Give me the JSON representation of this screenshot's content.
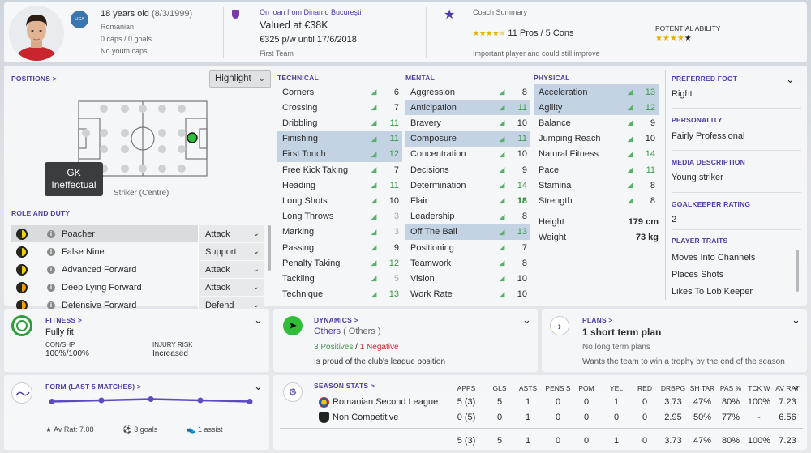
{
  "header": {
    "age": "18 years old",
    "dob": "(8/3/1999)",
    "nationality": "Romanian",
    "caps": "0 caps / 0 goals",
    "youth_caps": "No youth caps",
    "club_badge": "LIGA",
    "loan": "On loan from Dinamo Bucureşti",
    "value": "Valued at €38K",
    "wage": "€325 p/w until 17/6/2018",
    "squad": "First Team",
    "coach_title": "Coach Summary",
    "pros_cons": "11 Pros / 5 Cons",
    "coach_stars": "★★★★",
    "coach_star_half": "★",
    "coach_comment": "Important player and could still improve",
    "potential_title": "POTENTIAL ABILITY",
    "potential_stars": "★★★★",
    "potential_star_dark": "★"
  },
  "positions": {
    "title": "POSITIONS >",
    "highlight": "Highlight",
    "tooltip_line1": "GK",
    "tooltip_line2": "Ineffectual",
    "position_label": "Striker (Centre)"
  },
  "roles": {
    "title": "ROLE AND DUTY",
    "items": [
      {
        "name": "Poacher",
        "duty": "Attack"
      },
      {
        "name": "False Nine",
        "duty": "Support"
      },
      {
        "name": "Advanced Forward",
        "duty": "Attack"
      },
      {
        "name": "Deep Lying Forward",
        "duty": "Attack"
      },
      {
        "name": "Defensive Forward",
        "duty": "Defend"
      }
    ]
  },
  "technical": {
    "title": "TECHNICAL",
    "items": [
      {
        "name": "Corners",
        "value": "6"
      },
      {
        "name": "Crossing",
        "value": "7"
      },
      {
        "name": "Dribbling",
        "value": "11"
      },
      {
        "name": "Finishing",
        "value": "11"
      },
      {
        "name": "First Touch",
        "value": "12"
      },
      {
        "name": "Free Kick Taking",
        "value": "7"
      },
      {
        "name": "Heading",
        "value": "11"
      },
      {
        "name": "Long Shots",
        "value": "10"
      },
      {
        "name": "Long Throws",
        "value": "3"
      },
      {
        "name": "Marking",
        "value": "3"
      },
      {
        "name": "Passing",
        "value": "9"
      },
      {
        "name": "Penalty Taking",
        "value": "12"
      },
      {
        "name": "Tackling",
        "value": "5"
      },
      {
        "name": "Technique",
        "value": "13"
      }
    ]
  },
  "mental": {
    "title": "MENTAL",
    "items": [
      {
        "name": "Aggression",
        "value": "8"
      },
      {
        "name": "Anticipation",
        "value": "11"
      },
      {
        "name": "Bravery",
        "value": "10"
      },
      {
        "name": "Composure",
        "value": "11"
      },
      {
        "name": "Concentration",
        "value": "10"
      },
      {
        "name": "Decisions",
        "value": "9"
      },
      {
        "name": "Determination",
        "value": "14"
      },
      {
        "name": "Flair",
        "value": "18"
      },
      {
        "name": "Leadership",
        "value": "8"
      },
      {
        "name": "Off The Ball",
        "value": "13"
      },
      {
        "name": "Positioning",
        "value": "7"
      },
      {
        "name": "Teamwork",
        "value": "8"
      },
      {
        "name": "Vision",
        "value": "10"
      },
      {
        "name": "Work Rate",
        "value": "10"
      }
    ]
  },
  "physical": {
    "title": "PHYSICAL",
    "items": [
      {
        "name": "Acceleration",
        "value": "13"
      },
      {
        "name": "Agility",
        "value": "12"
      },
      {
        "name": "Balance",
        "value": "9"
      },
      {
        "name": "Jumping Reach",
        "value": "10"
      },
      {
        "name": "Natural Fitness",
        "value": "14"
      },
      {
        "name": "Pace",
        "value": "11"
      },
      {
        "name": "Stamina",
        "value": "8"
      },
      {
        "name": "Strength",
        "value": "8"
      }
    ],
    "height_label": "Height",
    "height": "179 cm",
    "weight_label": "Weight",
    "weight": "73 kg"
  },
  "info": {
    "foot_title": "PREFERRED FOOT",
    "foot": "Right",
    "personality_title": "PERSONALITY",
    "personality": "Fairly Professional",
    "media_title": "MEDIA DESCRIPTION",
    "media": "Young striker",
    "gk_title": "GOALKEEPER RATING",
    "gk": "2",
    "traits_title": "PLAYER TRAITS",
    "traits": [
      "Moves Into Channels",
      "Places Shots",
      "Likes To Lob Keeper"
    ]
  },
  "fitness": {
    "title": "FITNESS >",
    "status": "Fully fit",
    "con_label": "CON/SHP",
    "con": "100%/100%",
    "injury_label": "INJURY RISK",
    "injury": "Increased"
  },
  "dynamics": {
    "title": "DYNAMICS >",
    "group": "Others",
    "group_paren": "( Others )",
    "positives": "3 Positives",
    "sep": "/",
    "negatives": "1 Negative",
    "note": "Is proud of the club's league position"
  },
  "plans": {
    "title": "PLANS >",
    "short": "1 short term plan",
    "long": "No long term plans",
    "note": "Wants the team to win a trophy by the end of the season"
  },
  "form": {
    "title": "FORM (LAST 5 MATCHES) >",
    "ratings": [
      7.05,
      7.1,
      7.15,
      7.1,
      7.05
    ],
    "av_rat": "Av Rat: 7.08",
    "goals": "3 goals",
    "assists": "1 assist"
  },
  "season": {
    "title": "SEASON STATS >",
    "headers": [
      "APPS",
      "GLS",
      "ASTS",
      "PENS S",
      "POM",
      "YEL",
      "RED",
      "DRBPG",
      "SH TAR",
      "PAS %",
      "TCK W",
      "AV RAT"
    ],
    "rows": [
      {
        "comp": "Romanian Second League",
        "cells": [
          "5 (3)",
          "5",
          "1",
          "0",
          "0",
          "1",
          "0",
          "3.73",
          "47%",
          "80%",
          "100%",
          "7.23"
        ]
      },
      {
        "comp": "Non Competitive",
        "cells": [
          "0 (5)",
          "0",
          "1",
          "0",
          "0",
          "0",
          "0",
          "2.95",
          "50%",
          "77%",
          "-",
          "6.56"
        ]
      },
      {
        "comp": "",
        "cells": [
          "5 (3)",
          "5",
          "1",
          "0",
          "0",
          "1",
          "0",
          "3.73",
          "47%",
          "80%",
          "100%",
          "7.23"
        ]
      }
    ]
  },
  "colors": {
    "accent": "#4b3fa6",
    "good": "#3a9a46",
    "highlight": "#c3d3e4"
  }
}
